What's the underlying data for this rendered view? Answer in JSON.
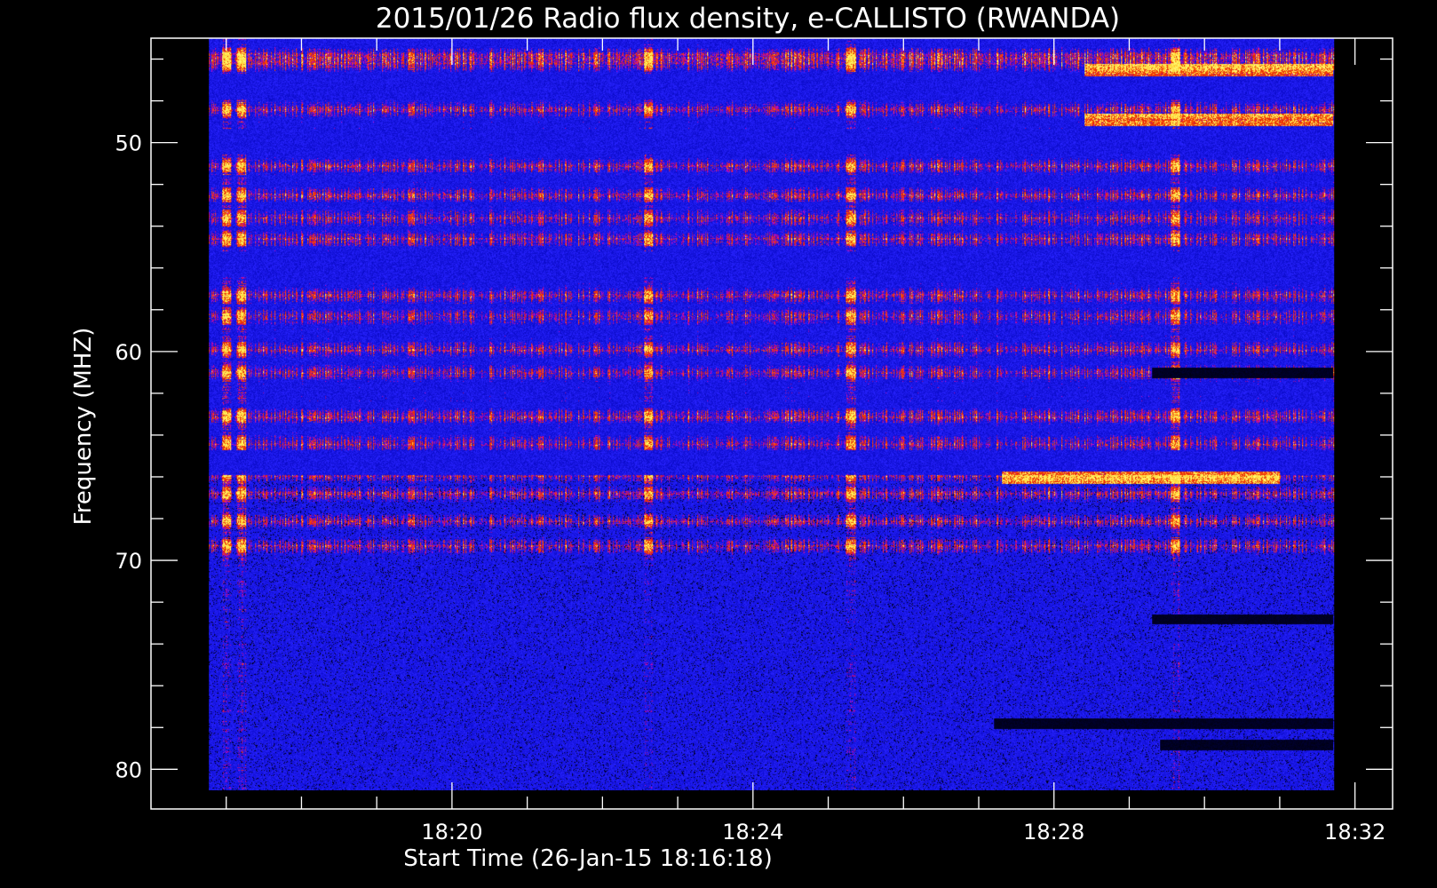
{
  "chart_data": {
    "type": "heatmap",
    "title": "2015/01/26  Radio flux density, e-CALLISTO (RWANDA)",
    "xlabel": "Start Time (26-Jan-15 18:16:18)",
    "ylabel": "Frequency (MHZ)",
    "x_tick_labels": [
      "18:20",
      "18:24",
      "18:28",
      "18:32"
    ],
    "x_tick_minutes": [
      20,
      24,
      28,
      32
    ],
    "xlim_minutes": [
      16.0,
      32.5
    ],
    "data_x_range_minutes": [
      16.77,
      31.72
    ],
    "y_tick_labels": [
      "50",
      "60",
      "70",
      "80"
    ],
    "y_tick_values": [
      50,
      60,
      70,
      80
    ],
    "ylim": [
      45.0,
      81.9
    ],
    "data_y_range": [
      45.0,
      81.0
    ],
    "y_inverted": true,
    "colormap": [
      "#000000",
      "#1010ff",
      "#ff2a00",
      "#ffff66"
    ],
    "background": "#000000",
    "strong_bands_mhz": [
      45.8,
      46.2,
      48.4,
      51.1,
      52.5,
      53.6,
      54.6,
      57.3,
      58.3,
      59.9,
      61.0,
      63.1,
      64.4,
      65.9,
      66.8,
      68.1,
      69.3
    ],
    "quiet_bands_mhz": [
      47.3,
      49.9,
      55.8,
      65.3
    ],
    "bright_vertical_minutes": [
      17.0,
      17.2,
      22.6,
      25.3,
      29.6
    ],
    "late_bright_bands": [
      {
        "freq": 46.5,
        "t0": 28.4,
        "t1": 31.7
      },
      {
        "freq": 48.9,
        "t0": 28.4,
        "t1": 31.7
      },
      {
        "freq": 66.0,
        "t0": 27.3,
        "t1": 31.0
      }
    ],
    "dark_bands": [
      {
        "freq": 61.0,
        "t0": 29.3,
        "t1": 31.7
      },
      {
        "freq": 72.8,
        "t0": 29.3,
        "t1": 31.7
      },
      {
        "freq": 77.8,
        "t0": 27.2,
        "t1": 31.7
      },
      {
        "freq": 78.8,
        "t0": 29.4,
        "t1": 31.7
      }
    ]
  }
}
